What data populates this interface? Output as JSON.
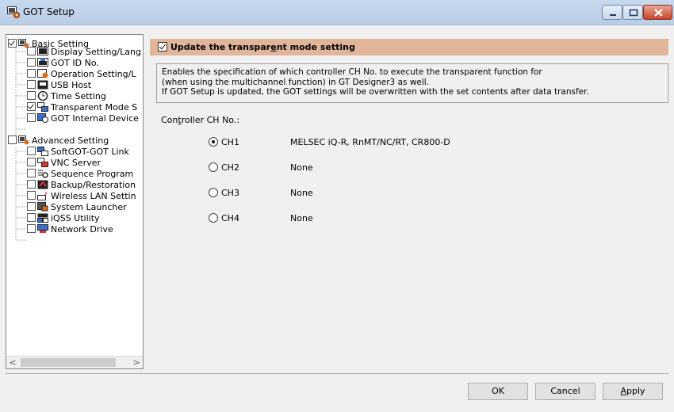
{
  "window": {
    "title": "GOT Setup"
  },
  "tree": {
    "items": [
      {
        "label": "Basic Setting",
        "checked": true,
        "level": 0
      },
      {
        "label": "Display Setting/Lang",
        "checked": false,
        "level": 1
      },
      {
        "label": "GOT ID No.",
        "checked": false,
        "level": 1
      },
      {
        "label": "Operation Setting/L",
        "checked": false,
        "level": 1
      },
      {
        "label": "USB Host",
        "checked": false,
        "level": 1
      },
      {
        "label": "Time Setting",
        "checked": false,
        "level": 1
      },
      {
        "label": "Transparent Mode S",
        "checked": true,
        "level": 1
      },
      {
        "label": "GOT Internal Device",
        "checked": false,
        "level": 1
      },
      {
        "label": "Advanced Setting",
        "checked": false,
        "level": 0
      },
      {
        "label": "SoftGOT-GOT Link",
        "checked": false,
        "level": 1
      },
      {
        "label": "VNC Server",
        "checked": false,
        "level": 1
      },
      {
        "label": "Sequence Program ",
        "checked": false,
        "level": 1
      },
      {
        "label": "Backup/Restoration",
        "checked": false,
        "level": 1
      },
      {
        "label": "Wireless LAN Settin",
        "checked": false,
        "level": 1
      },
      {
        "label": "System Launcher",
        "checked": false,
        "level": 1
      },
      {
        "label": "iQSS Utility",
        "checked": false,
        "level": 1
      },
      {
        "label": "Network Drive",
        "checked": false,
        "level": 1
      }
    ],
    "scroll_left": "<",
    "scroll_right": ">"
  },
  "content": {
    "header_pre": "Update the transpar",
    "header_u": "e",
    "header_post": "nt mode setting",
    "header_checked": true,
    "description": [
      "Enables the specification of which controller CH No. to execute the transparent function for",
      "(when using the multichannel function) in GT Designer3 as well.",
      "If GOT Setup is updated, the GOT settings will be overwritten with the set contents after data transfer."
    ],
    "ctrl_pre": "Con",
    "ctrl_u": "t",
    "ctrl_post": "roller CH No.:",
    "channels": [
      {
        "label": "CH1",
        "value": "MELSEC iQ-R, RnMT/NC/RT, CR800-D",
        "selected": true
      },
      {
        "label": "CH2",
        "value": "None",
        "selected": false
      },
      {
        "label": "CH3",
        "value": "None",
        "selected": false
      },
      {
        "label": "CH4",
        "value": "None",
        "selected": false
      }
    ]
  },
  "buttons": {
    "ok": "OK",
    "cancel": "Cancel",
    "apply_u": "A",
    "apply_rest": "pply"
  }
}
